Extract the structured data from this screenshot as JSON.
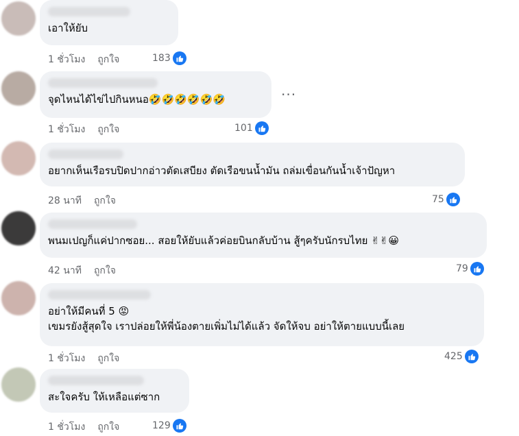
{
  "comments": [
    {
      "text": "เอาให้ยับ",
      "time": "1 ชั่วโมง",
      "like": "ถูกใจ",
      "count": "183"
    },
    {
      "text": "จุดไหนได้ไข่ไปกินหนอ",
      "emoji": "🤣🤣🤣🤣🤣🤣",
      "time": "1 ชั่วโมง",
      "like": "ถูกใจ",
      "count": "101",
      "more": "···"
    },
    {
      "text": "อยากเห็นเรือรบปิดปากอ่าวตัดเสบียง ตัดเรือขนน้ำมัน ถล่มเขื่อนกันน้ำเจ้าปัญหา",
      "time": "28 นาที",
      "like": "ถูกใจ",
      "count": "75"
    },
    {
      "text": "พนมเปญก็แค่ปากซอย... สอยให้ยับแล้วค่อยบินกลับบ้าน สู้ๆครับนักรบไทย",
      "emoji": "✌✌😀",
      "time": "42 นาที",
      "like": "ถูกใจ",
      "count": "79"
    },
    {
      "text": "อย่าให้มีคนที่ 5",
      "emoji": "😡",
      "text2": "เขมรยังสู้สุดใจ เราปล่อยให้พี่น้องตายเพิ่มไม่ได้แล้ว จัดให้จบ อย่าให้ตายแบบนี้เลย",
      "time": "1 ชั่วโมง",
      "like": "ถูกใจ",
      "count": "425"
    },
    {
      "text": "สะใจครับ ให้เหลือแต่ซาก",
      "time": "1 ชั่วโมง",
      "like": "ถูกใจ",
      "count": "129"
    }
  ]
}
